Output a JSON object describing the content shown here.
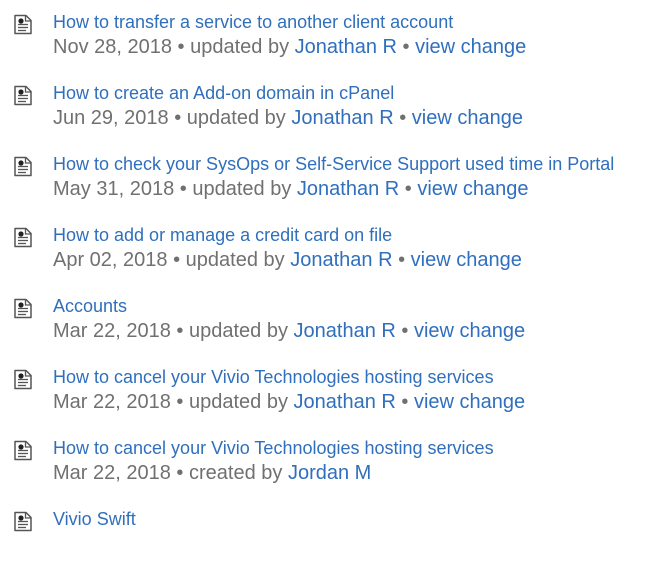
{
  "items": [
    {
      "title": "How to transfer a service to another client account",
      "date": "Nov 28, 2018",
      "action": "updated by",
      "author": "Jonathan R",
      "change": "view change"
    },
    {
      "title": "How to create an Add-on domain in cPanel",
      "date": "Jun 29, 2018",
      "action": "updated by",
      "author": "Jonathan R",
      "change": "view change"
    },
    {
      "title": "How to check your SysOps or Self-Service Support used time in Portal",
      "date": "May 31, 2018",
      "action": "updated by",
      "author": "Jonathan R",
      "change": "view change"
    },
    {
      "title": "How to add or manage a credit card on file",
      "date": "Apr 02, 2018",
      "action": "updated by",
      "author": "Jonathan R",
      "change": "view change"
    },
    {
      "title": "Accounts",
      "date": "Mar 22, 2018",
      "action": "updated by",
      "author": "Jonathan R",
      "change": "view change"
    },
    {
      "title": "How to cancel your Vivio Technologies hosting services",
      "date": "Mar 22, 2018",
      "action": "updated by",
      "author": "Jonathan R",
      "change": "view change"
    },
    {
      "title": "How to cancel your Vivio Technologies hosting services",
      "date": "Mar 22, 2018",
      "action": "created by",
      "author": "Jordan M",
      "change": ""
    },
    {
      "title": "Vivio Swift",
      "date": "",
      "action": "",
      "author": "",
      "change": ""
    }
  ],
  "separator": "•",
  "icon": "page-document-icon",
  "colors": {
    "link": "#2f6fbd",
    "meta": "#707070"
  }
}
